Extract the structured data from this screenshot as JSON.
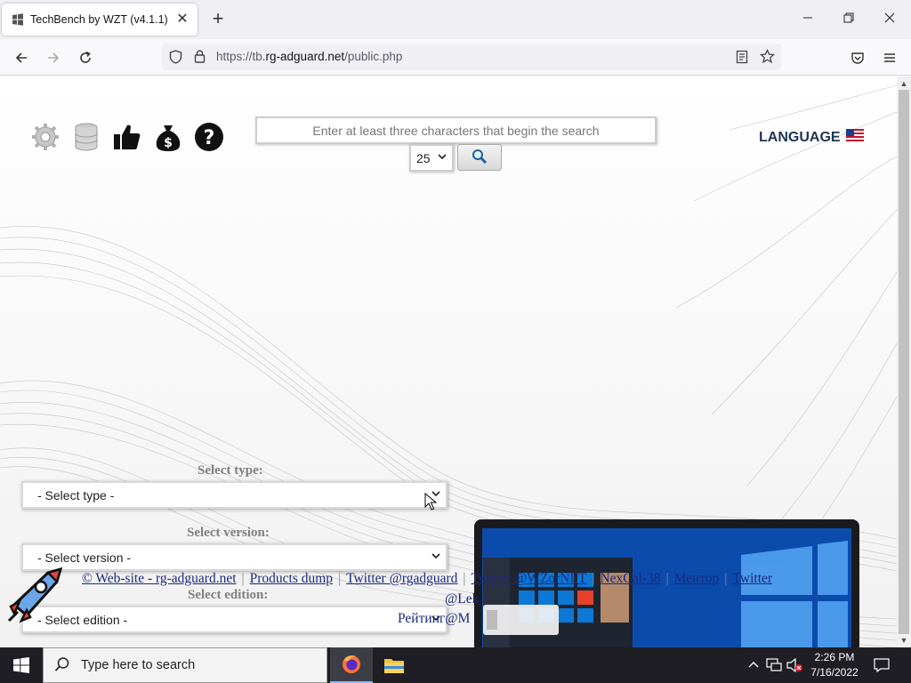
{
  "browser": {
    "tab_title": "TechBench by WZT (v4.1.1)",
    "url_prefix": "https://tb.",
    "url_domain": "rg-adguard.net",
    "url_path": "/public.php"
  },
  "header": {
    "search_placeholder": "Enter at least three characters that begin the search",
    "results_count": "25",
    "language_label": "LANGUAGE"
  },
  "form": {
    "type_label": "Select type:",
    "type_value": "- Select type -",
    "version_label": "Select version:",
    "version_value": "- Select version -",
    "edition_label": "Select edition:",
    "edition_value": "- Select edition -"
  },
  "footer": {
    "website": "© Web-site - rg-adguard.net",
    "products_dump": "Products dump",
    "twitter": "Twitter @rgadguard",
    "twitter2": "Twitter @WZorNET",
    "nexcal": "NexCal-38",
    "mentor": "Ментор",
    "twitter3": "Twitter",
    "handle": "@Lek",
    "rating": "Рейтинг@M"
  },
  "taskbar": {
    "search_text": "Type here to search",
    "time": "2:26 PM",
    "date": "7/16/2022"
  },
  "colors": {
    "link": "#1a2a80",
    "language": "#1d3557",
    "label_gray": "#808080"
  }
}
